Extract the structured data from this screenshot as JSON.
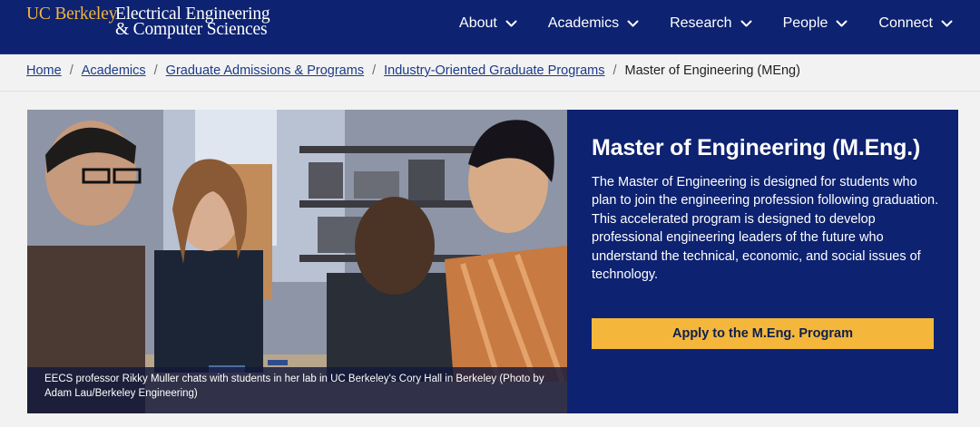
{
  "header": {
    "logo": {
      "uc_berkeley": "UC Berkeley",
      "line1": "Electrical Engineering",
      "line2": "& Computer Sciences"
    },
    "nav": [
      {
        "label": "About",
        "icon": "chevron-down-icon"
      },
      {
        "label": "Academics",
        "icon": "chevron-down-icon"
      },
      {
        "label": "Research",
        "icon": "chevron-down-icon"
      },
      {
        "label": "People",
        "icon": "chevron-down-icon"
      },
      {
        "label": "Connect",
        "icon": "chevron-down-icon"
      }
    ]
  },
  "breadcrumb": {
    "items": [
      {
        "label": "Home"
      },
      {
        "label": "Academics"
      },
      {
        "label": "Graduate Admissions & Programs"
      },
      {
        "label": "Industry-Oriented Graduate Programs"
      }
    ],
    "separator": "/",
    "current": "Master of Engineering (MEng)"
  },
  "hero": {
    "caption": "EECS professor Rikky Muller chats with students in her lab in UC Berkeley's Cory Hall in Berkeley (Photo by Adam Lau/Berkeley Engineering)",
    "title": "Master of Engineering (M.Eng.)",
    "description": "The Master of Engineering is designed for students who plan to join the engineering profession following graduation. This accelerated program is designed to develop professional engineering leaders of the future who understand the technical, economic, and social issues of technology.",
    "cta_label": "Apply to the M.Eng. Program"
  },
  "colors": {
    "brand_navy": "#0d2270",
    "brand_gold": "#f2b53b",
    "button_gold": "#f4b73b",
    "link_blue": "#1a3a8a",
    "page_background": "#f2f2f2"
  }
}
